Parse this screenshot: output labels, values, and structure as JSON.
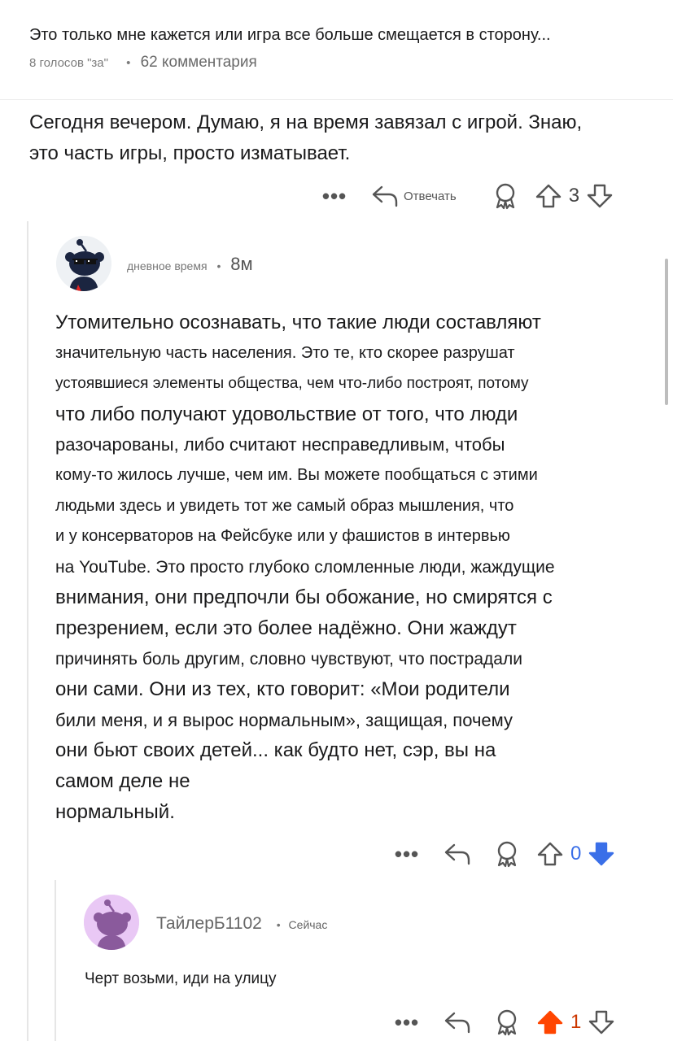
{
  "post": {
    "title": "Это только мне кажется или игра все больше смещается в сторону...",
    "votes": "8 голосов \"за\"",
    "comments": "62 комментария"
  },
  "comment0": {
    "text_line1": "Сегодня вечером. Думаю, я на время завязал с игрой. Знаю,",
    "text_line2": "это часть игры, просто изматывает.",
    "reply_label": "Отвечать",
    "vote_count": "3"
  },
  "comment1": {
    "author": "дневное время",
    "time": "8м",
    "lines": [
      "Утомительно осознавать, что такие люди составляют",
      "значительную часть населения. Это те, кто скорее разрушат",
      "устоявшиеся элементы общества, чем что-либо построят, потому",
      "что либо получают удовольствие от того, что люди",
      "разочарованы, либо считают несправедливым, чтобы",
      "кому-то жилось лучше, чем им. Вы можете пообщаться с этими",
      "людьми здесь и увидеть тот же самый образ мышления, что",
      "и у консерваторов на Фейсбуке или у фашистов в интервью",
      "на YouTube. Это просто глубоко сломленные люди, жаждущие",
      "внимания, они предпочли бы обожание, но смирятся с",
      "презрением, если это более надёжно. Они жаждут",
      "причинять боль другим, словно чувствуют, что пострадали",
      "они сами. Они из тех, кто говорит: «Мои родители",
      "били меня, и я вырос нормальным», защищая, почему",
      "они бьют своих детей... как будто нет, сэр, вы на",
      "самом деле не",
      "нормальный."
    ],
    "vote_count": "0"
  },
  "comment2": {
    "author": "ТайлерБ1102",
    "time": "Сейчас",
    "text": "Черт возьми, иди на улицу",
    "vote_count": "1"
  },
  "colors": {
    "upvote": "#ff4500",
    "downvote": "#3a6fe8",
    "thread_line": "#e6e6e6",
    "text": "#1a1a1b"
  },
  "icons": [
    "more-icon",
    "reply-icon",
    "award-icon",
    "upvote-icon",
    "downvote-icon",
    "avatar-icon"
  ]
}
